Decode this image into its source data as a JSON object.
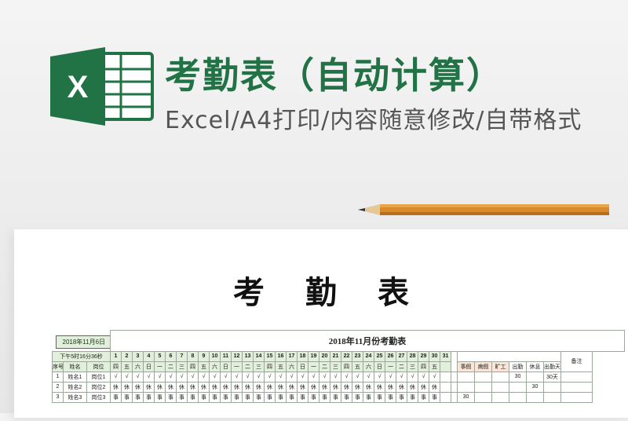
{
  "banner": {
    "logo_letter": "X",
    "title": "考勤表（自动计算）",
    "subtitle": "Excel/A4打印/内容随意修改/自带格式",
    "brand_color": "#217346"
  },
  "document": {
    "title_chars": [
      "考",
      "勤",
      "表"
    ],
    "date_box": "2018年11月6日",
    "sheet_title": "2018年11月份考勤表",
    "time": "下午5时16分36秒",
    "days": [
      "1",
      "2",
      "3",
      "4",
      "5",
      "6",
      "7",
      "8",
      "9",
      "10",
      "11",
      "12",
      "13",
      "14",
      "15",
      "16",
      "17",
      "18",
      "19",
      "20",
      "21",
      "22",
      "23",
      "24",
      "25",
      "26",
      "27",
      "28",
      "29",
      "30",
      "31"
    ],
    "weekdays": [
      "四",
      "五",
      "六",
      "日",
      "一",
      "二",
      "三",
      "四",
      "五",
      "六",
      "日",
      "一",
      "二",
      "三",
      "四",
      "五",
      "六",
      "日",
      "一",
      "二",
      "三",
      "四",
      "五",
      "六",
      "日",
      "一",
      "二",
      "三",
      "四",
      "五",
      ""
    ],
    "headers": {
      "no": "序号",
      "name": "姓名",
      "position": "岗位",
      "leave": "事假",
      "sick": "病假",
      "absent": "旷工",
      "attend": "出勤",
      "rest": "休息",
      "work_days": "出勤天数",
      "remark": "备注"
    },
    "rows": [
      {
        "no": "1",
        "name": "姓名1",
        "position": "岗位1",
        "marks": [
          "√",
          "√",
          "√",
          "√",
          "√",
          "√",
          "√",
          "√",
          "√",
          "√",
          "√",
          "√",
          "√",
          "√",
          "√",
          "√",
          "√",
          "√",
          "√",
          "√",
          "√",
          "√",
          "√",
          "√",
          "√",
          "√",
          "√",
          "√",
          "√",
          "√",
          ""
        ],
        "leave": "",
        "sick": "",
        "absent": "",
        "attend": "30",
        "rest": "",
        "work_days": "30天"
      },
      {
        "no": "2",
        "name": "姓名2",
        "position": "岗位2",
        "marks": [
          "休",
          "休",
          "休",
          "休",
          "休",
          "休",
          "休",
          "休",
          "休",
          "休",
          "休",
          "休",
          "休",
          "休",
          "休",
          "休",
          "休",
          "休",
          "休",
          "休",
          "休",
          "休",
          "休",
          "休",
          "休",
          "休",
          "休",
          "休",
          "休",
          "休",
          ""
        ],
        "leave": "",
        "sick": "",
        "absent": "",
        "attend": "",
        "rest": "30",
        "work_days": ""
      },
      {
        "no": "3",
        "name": "姓名3",
        "position": "岗位3",
        "marks": [
          "事",
          "事",
          "事",
          "事",
          "事",
          "事",
          "事",
          "事",
          "事",
          "事",
          "事",
          "事",
          "事",
          "事",
          "事",
          "事",
          "事",
          "事",
          "事",
          "事",
          "事",
          "事",
          "事",
          "事",
          "事",
          "事",
          "事",
          "事",
          "事",
          "事",
          ""
        ],
        "leave": "30",
        "sick": "",
        "absent": "",
        "attend": "",
        "rest": "",
        "work_days": ""
      }
    ]
  }
}
